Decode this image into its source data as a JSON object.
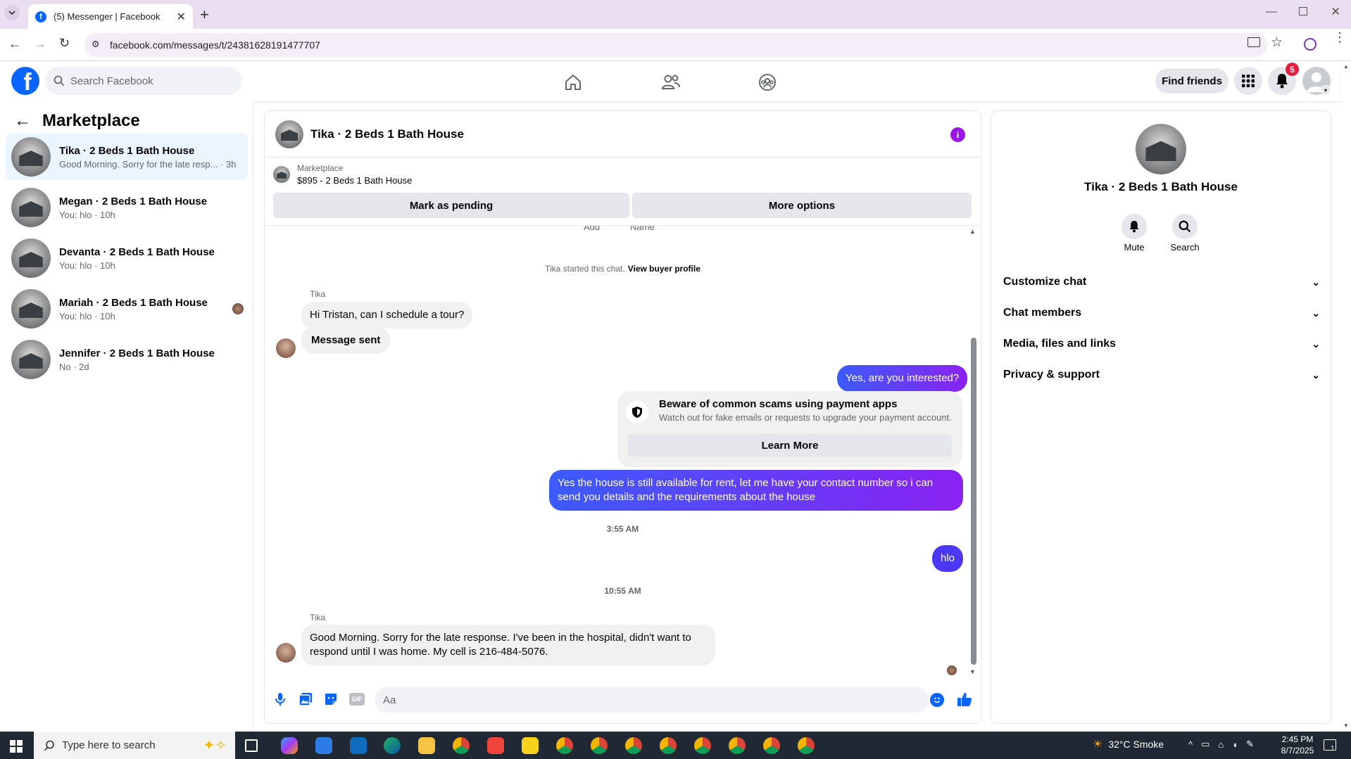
{
  "browser": {
    "tab_title": "(5) Messenger | Facebook",
    "url": "facebook.com/messages/t/24381628191477707"
  },
  "header": {
    "search_placeholder": "Search Facebook",
    "find_friends": "Find friends",
    "notifications_count": "5"
  },
  "sidebar": {
    "title": "Marketplace",
    "conversations": [
      {
        "name": "Tika · 2 Beds 1 Bath House",
        "preview": "Good Morning. Sorry for the late resp... · 3h"
      },
      {
        "name": "Megan · 2 Beds 1 Bath House",
        "preview": "You: hlo · 10h"
      },
      {
        "name": "Devanta · 2 Beds 1 Bath House",
        "preview": "You: hlo · 10h"
      },
      {
        "name": "Mariah · 2 Beds 1 Bath House",
        "preview": "You: hlo · 10h"
      },
      {
        "name": "Jennifer · 2 Beds 1 Bath House",
        "preview": "No · 2d"
      }
    ]
  },
  "chat": {
    "title": "Tika · 2 Beds 1 Bath House",
    "listing_source": "Marketplace",
    "listing_title": "$895 - 2 Beds 1 Bath House",
    "mark_pending": "Mark as pending",
    "more_options": "More options",
    "cut_add": "Add",
    "cut_name": "Name",
    "started_text": "Tika started this chat.",
    "view_buyer": "View buyer profile",
    "sender_1": "Tika",
    "msg_1": "Hi Tristan, can I schedule a tour?",
    "msg_2": "Message sent",
    "out_1": "Yes, are you interested?",
    "scam_title": "Beware of common scams using payment apps",
    "scam_body": "Watch out for fake emails or requests to upgrade your payment account.",
    "learn_more": "Learn More",
    "out_2": "Yes the house is still available for rent, let me have your contact number so i can send you details and the requirements about the house",
    "time_1": "3:55 AM",
    "out_3": "hlo",
    "time_2": "10:55 AM",
    "sender_2": "Tika",
    "msg_3": "Good Morning. Sorry for the late response. I've been in the hospital, didn't want to respond until I was home. My cell is 216-484-5076.",
    "composer_placeholder": "Aa",
    "gif_label": "GIF"
  },
  "info_panel": {
    "title": "Tika · 2 Beds 1 Bath House",
    "mute": "Mute",
    "search": "Search",
    "sections": [
      "Customize chat",
      "Chat members",
      "Media, files and links",
      "Privacy & support"
    ]
  },
  "taskbar": {
    "search_placeholder": "Type here to search",
    "weather": "32°C  Smoke",
    "time": "2:45 PM",
    "date": "8/7/2025",
    "notif": "1"
  },
  "colors": {
    "fb_blue": "#0866ff",
    "bubble_out_start": "#3b5bfd",
    "bubble_out_end": "#8a22f2",
    "badge_red": "#e41e3f"
  }
}
